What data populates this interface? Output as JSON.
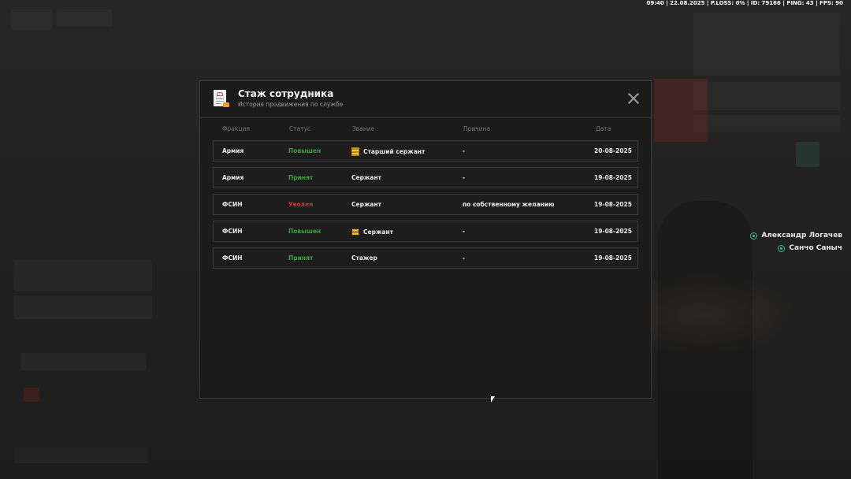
{
  "hud": {
    "status_bar": "09:40 | 22.08.2025 | P.LOSS: 0% | ID: 79166 | PING: 43 | FPS: 90"
  },
  "voice_chat": [
    {
      "name": "Александр Логачев"
    },
    {
      "name": "Санчо Саныч"
    }
  ],
  "modal": {
    "title": "Стаж сотрудника",
    "subtitle": "История продвижения по службе",
    "icon": "document-icon",
    "close_icon": "close-icon",
    "columns": {
      "faction": "Фракция",
      "status": "Статус",
      "rank": "Звание",
      "reason": "Причина",
      "date": "Дата"
    },
    "rows": [
      {
        "faction": "Армия",
        "status": "Повышен",
        "status_color": "#36a33a",
        "rank": "Старший сержант",
        "rank_icon": "rank-insignia-icon",
        "reason": "-",
        "date": "20-08-2025"
      },
      {
        "faction": "Армия",
        "status": "Принят",
        "status_color": "#36a33a",
        "rank": "Сержант",
        "rank_icon": "",
        "reason": "-",
        "date": "19-08-2025"
      },
      {
        "faction": "ФСИН",
        "status": "Уволен",
        "status_color": "#c2392c",
        "rank": "Сержант",
        "rank_icon": "",
        "reason": "по собственному желанию",
        "date": "19-08-2025"
      },
      {
        "faction": "ФСИН",
        "status": "Повышен",
        "status_color": "#36a33a",
        "rank": "Сержант",
        "rank_icon": "rank-insignia-icon",
        "reason": "-",
        "date": "19-08-2025"
      },
      {
        "faction": "ФСИН",
        "status": "Принят",
        "status_color": "#36a33a",
        "rank": "Стажер",
        "rank_icon": "",
        "reason": "-",
        "date": "19-08-2025"
      }
    ]
  },
  "colors": {
    "modal_bg": "#1b1b1b",
    "positive": "#36a33a",
    "negative": "#c2392c",
    "voice_accent": "#35c28a"
  }
}
